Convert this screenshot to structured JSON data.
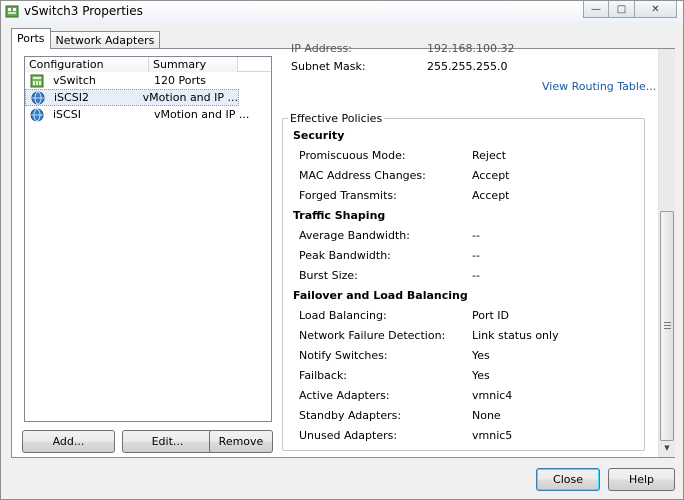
{
  "window": {
    "title": "vSwitch3 Properties",
    "controls": {
      "minimize": "—",
      "maximize": "□",
      "close": "✕"
    }
  },
  "tabs": [
    {
      "label": "Ports",
      "active": true
    },
    {
      "label": "Network Adapters",
      "active": false
    }
  ],
  "port_list": {
    "columns": [
      "Configuration",
      "Summary"
    ],
    "rows": [
      {
        "name": "vSwitch",
        "summary": "120 Ports",
        "icon": "vswitch-icon"
      },
      {
        "name": "iSCSI2",
        "summary": "vMotion and IP ...",
        "icon": "vmkernel-port-icon",
        "selected": true
      },
      {
        "name": "iSCSI",
        "summary": "vMotion and IP ...",
        "icon": "vmkernel-port-icon"
      }
    ]
  },
  "buttons": {
    "add": "Add...",
    "edit": "Edit...",
    "remove": "Remove",
    "close": "Close",
    "help": "Help"
  },
  "ip_settings": {
    "ip_label": "IP Address:",
    "ip_value": "192.168.100.32",
    "subnet_label": "Subnet Mask:",
    "subnet_value": "255.255.255.0",
    "routing_link": "View Routing Table..."
  },
  "effective_policies": {
    "legend": "Effective Policies",
    "security": {
      "heading": "Security",
      "rows": [
        {
          "label": "Promiscuous Mode:",
          "value": "Reject"
        },
        {
          "label": "MAC Address Changes:",
          "value": "Accept"
        },
        {
          "label": "Forged Transmits:",
          "value": "Accept"
        }
      ]
    },
    "traffic_shaping": {
      "heading": "Traffic Shaping",
      "rows": [
        {
          "label": "Average Bandwidth:",
          "value": "--"
        },
        {
          "label": "Peak Bandwidth:",
          "value": "--"
        },
        {
          "label": "Burst Size:",
          "value": "--"
        }
      ]
    },
    "failover": {
      "heading": "Failover and Load Balancing",
      "rows": [
        {
          "label": "Load Balancing:",
          "value": "Port ID"
        },
        {
          "label": "Network Failure Detection:",
          "value": "Link status only"
        },
        {
          "label": "Notify Switches:",
          "value": "Yes"
        },
        {
          "label": "Failback:",
          "value": "Yes"
        },
        {
          "label": "Active Adapters:",
          "value": "vmnic4"
        },
        {
          "label": "Standby Adapters:",
          "value": "None"
        },
        {
          "label": "Unused Adapters:",
          "value": "vmnic5"
        }
      ]
    }
  },
  "scrollbar": {
    "position": 0.75
  }
}
